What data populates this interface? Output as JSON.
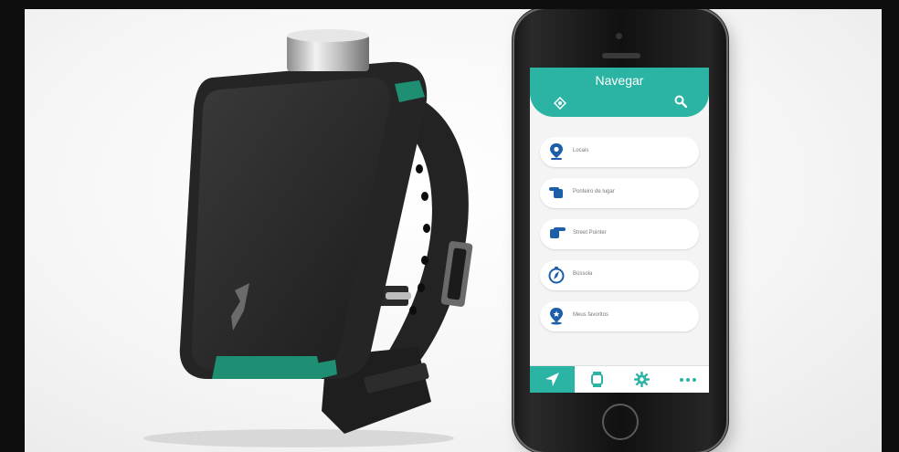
{
  "app": {
    "title": "Navegar"
  },
  "header": {
    "left_icon": "location-target-icon",
    "right_icon": "search-icon"
  },
  "menu": {
    "items": [
      {
        "label": "Locais",
        "icon": "location-pin-icon"
      },
      {
        "label": "Ponteiro de lugar",
        "icon": "pointing-hand-icon"
      },
      {
        "label": "Street Pointer",
        "icon": "pointing-hand-icon"
      },
      {
        "label": "Bússola",
        "icon": "compass-icon"
      },
      {
        "label": "Meus favoritos",
        "icon": "favorite-pin-icon"
      }
    ]
  },
  "tabs": [
    {
      "icon": "navigation-arrow-icon",
      "active": true
    },
    {
      "icon": "watch-icon",
      "active": false
    },
    {
      "icon": "gear-icon",
      "active": false
    },
    {
      "icon": "more-icon",
      "active": false
    }
  ],
  "colors": {
    "accent": "#2bb3a3",
    "band": "#2a2a2a",
    "band_trim": "#1f8f73"
  }
}
